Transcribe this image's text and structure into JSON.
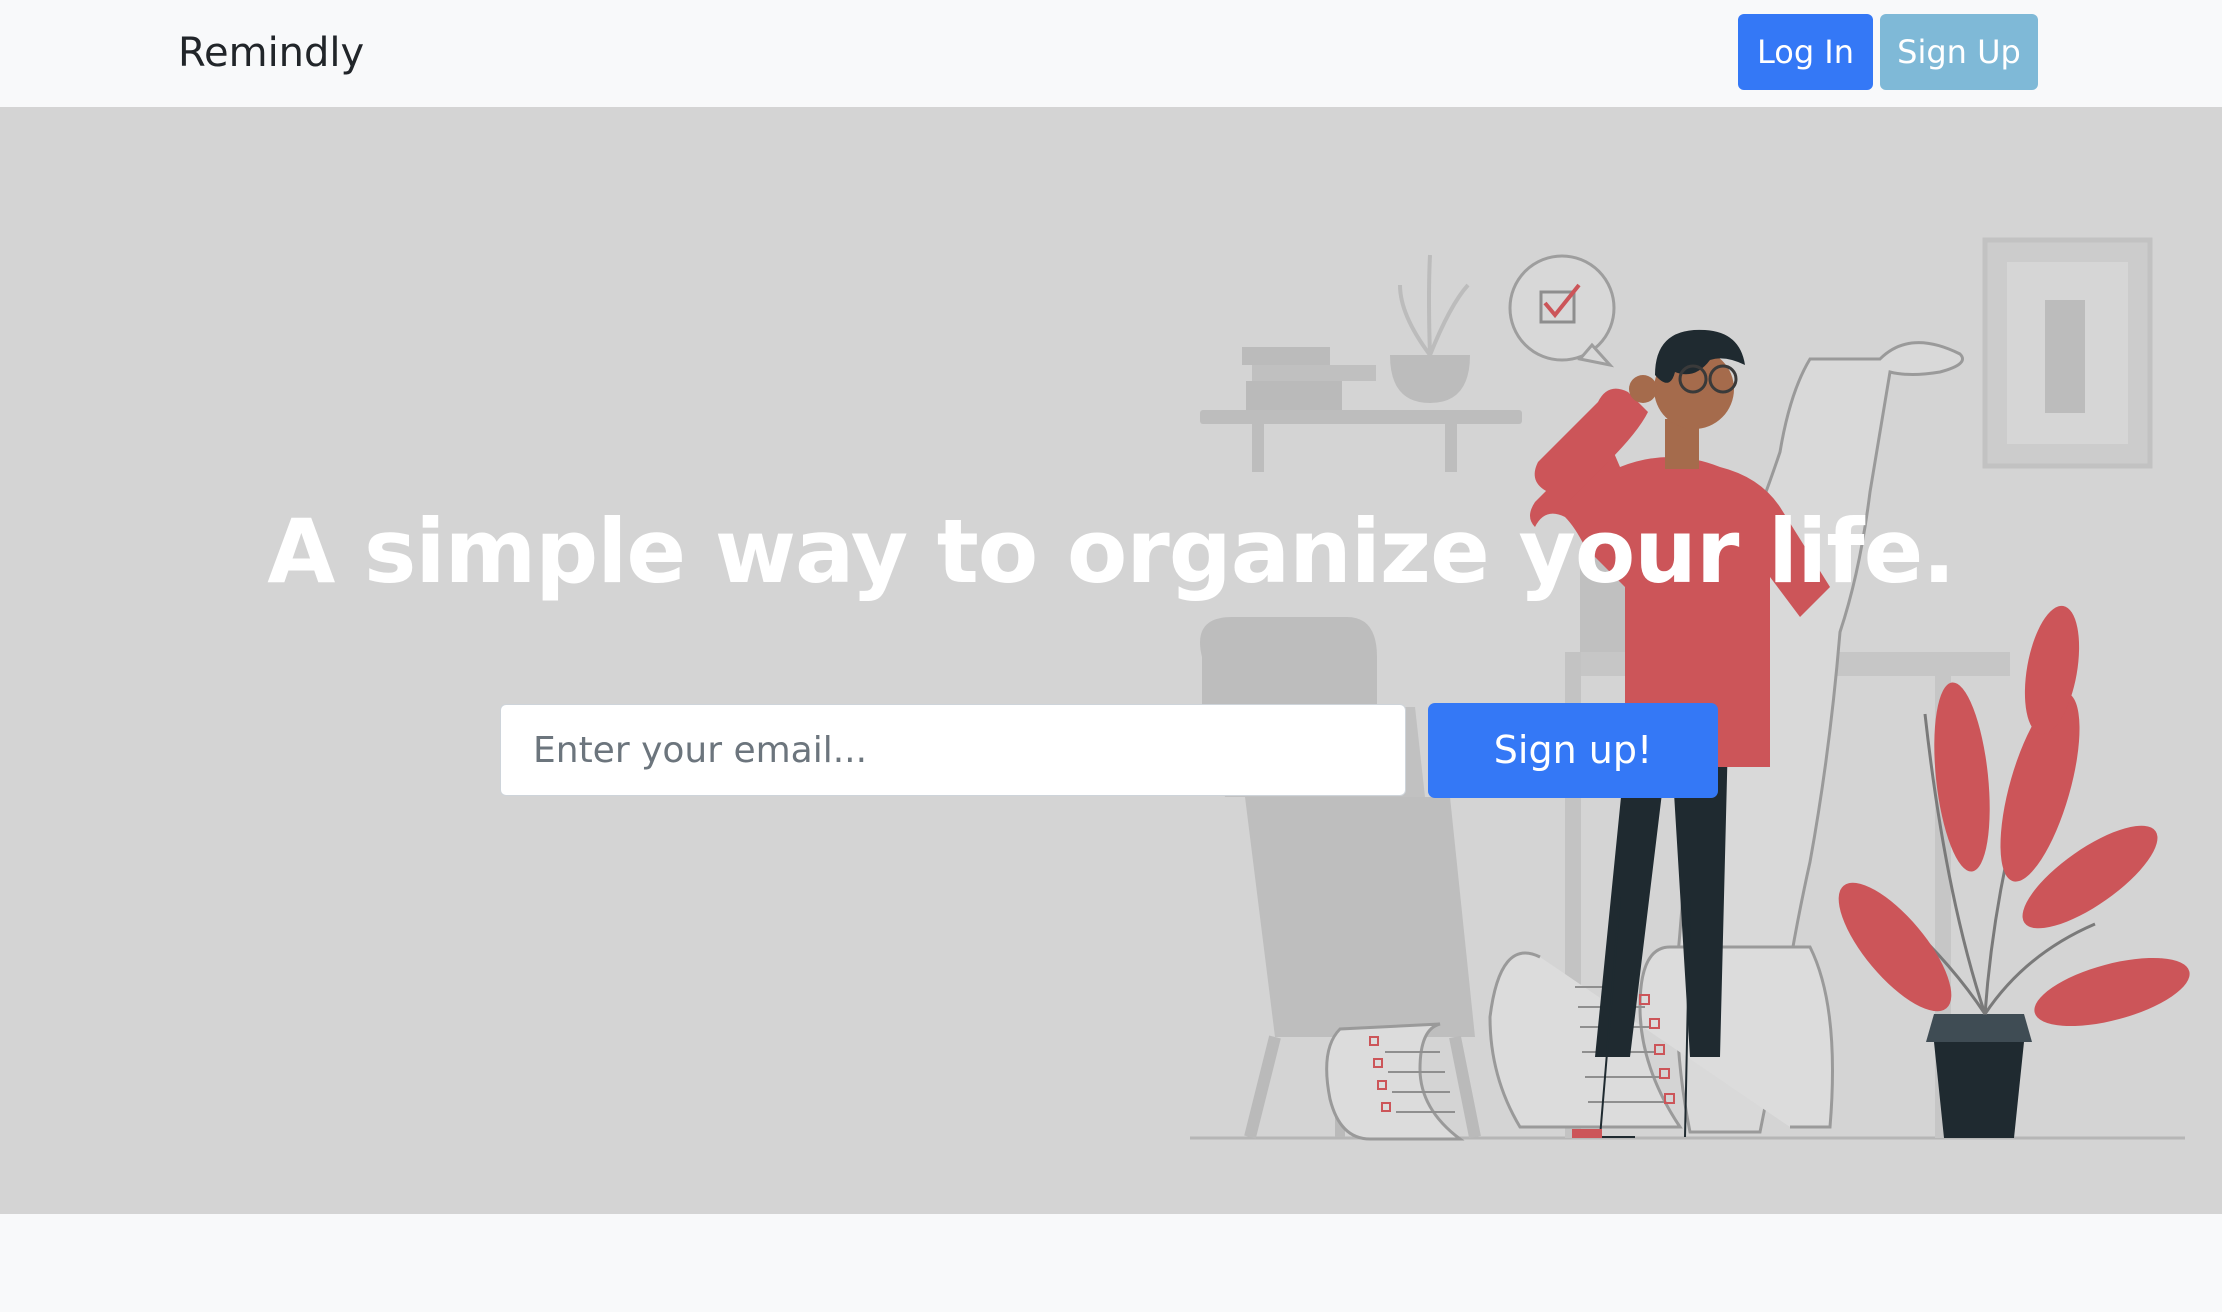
{
  "navbar": {
    "brand": "Remindly",
    "login_label": "Log In",
    "signup_label": "Sign Up",
    "login_color": "#3478f6",
    "signup_color": "#7fb9d7"
  },
  "hero": {
    "headline": "A simple way to organize your life.",
    "email_placeholder": "Enter your email...",
    "cta_label": "Sign up!",
    "cta_color": "#3478f6",
    "background_color": "#d4d4d4",
    "accent_color": "#cc5559",
    "illustration": "person-with-todo-list-illustration"
  }
}
